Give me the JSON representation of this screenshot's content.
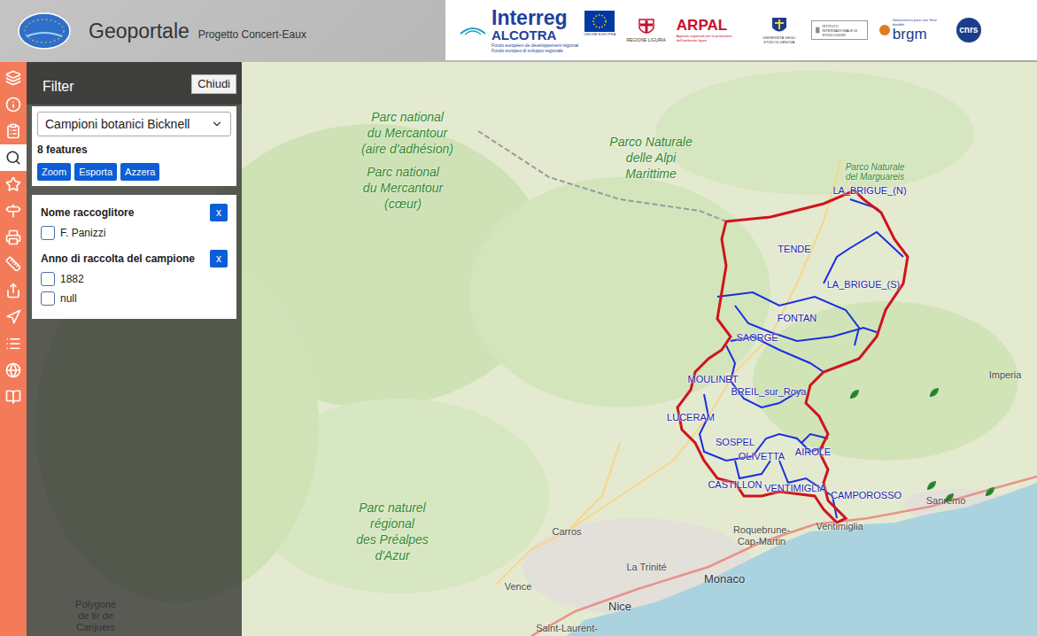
{
  "header": {
    "title": "Geoportale",
    "subtitle": "Progetto Concert-Eaux"
  },
  "partners": {
    "programme": "Interreg",
    "programme_sub": "ALCOTRA",
    "fund_fr": "Fonds européen de développement régional",
    "fund_it": "Fondo europeo di sviluppo regionale",
    "eu": "UNIONE EUROPEA",
    "regione": "REGIONE LIGURIA",
    "arpal": "ARPAL",
    "arpal_caption": "Agenzia regionale per la protezione dell'ambiente ligure",
    "university": "UNIVERSITÀ DEGLI STUDI DI GENOVA",
    "institute": "ISTITUTO INTERNAZIONALE DI STUDI LIGURI",
    "brgm": "brgm",
    "brgm_caption": "Géosciences pour une Terre durable",
    "cnrs": "cnrs"
  },
  "toolbar": [
    {
      "selected": false
    },
    {
      "selected": false
    },
    {
      "selected": false
    },
    {
      "selected": true
    },
    {
      "selected": false
    },
    {
      "selected": false
    },
    {
      "selected": false
    },
    {
      "selected": false
    },
    {
      "selected": false
    },
    {
      "selected": false
    },
    {
      "selected": false
    },
    {
      "selected": false
    },
    {
      "selected": false
    }
  ],
  "filter_panel": {
    "title": "Filter",
    "close": "Chiudi",
    "layer": "Campioni botanici Bicknell",
    "count": "8 features",
    "actions": [
      "Zoom",
      "Esporta",
      "Azzera"
    ],
    "groups": [
      {
        "title": "Nome raccoglitore",
        "clear": "x",
        "options": [
          {
            "label": "F. Panizzi",
            "checked": false
          }
        ]
      },
      {
        "title": "Anno di raccolta del campione",
        "clear": "x",
        "options": [
          {
            "label": "1882",
            "checked": false
          },
          {
            "label": "null",
            "checked": false
          }
        ]
      }
    ]
  },
  "map": {
    "labels": [
      {
        "lines": [
          "Parc national",
          "du Mercantour",
          "(aire d'adhésion)"
        ],
        "kind": "park"
      },
      {
        "lines": [
          "Parc national",
          "du Mercantour",
          "(cœur)"
        ],
        "kind": "park"
      },
      {
        "lines": [
          "Parco Naturale",
          "delle Alpi",
          "Marittime"
        ],
        "kind": "park"
      },
      {
        "lines": [
          "Parco Naturale",
          "del Marguareis"
        ],
        "kind": "smallpark"
      },
      {
        "lines": [
          "Parc naturel",
          "régional",
          "des Préalpes",
          "d'Azur"
        ],
        "kind": "park"
      },
      {
        "lines": [
          "Polygone",
          "de tir de",
          "Canjuers"
        ],
        "kind": "place"
      },
      {
        "lines": [
          "Imperia"
        ],
        "kind": "place"
      },
      {
        "lines": [
          "Sanremo"
        ],
        "kind": "place"
      },
      {
        "lines": [
          "Carros"
        ],
        "kind": "place"
      },
      {
        "lines": [
          "La Trinité"
        ],
        "kind": "place"
      },
      {
        "lines": [
          "Vence"
        ],
        "kind": "place"
      },
      {
        "lines": [
          "Nice"
        ],
        "kind": "city"
      },
      {
        "lines": [
          "Monaco"
        ],
        "kind": "city"
      },
      {
        "lines": [
          "Roquebrune-",
          "Cap-Martin"
        ],
        "kind": "place"
      },
      {
        "lines": [
          "Ventimiglia"
        ],
        "kind": "place"
      },
      {
        "lines": [
          "Saint-Laurent-"
        ],
        "kind": "place"
      },
      {
        "lines": [
          "LA_BRIGUE_(N)"
        ],
        "kind": "commune"
      },
      {
        "lines": [
          "TENDE"
        ],
        "kind": "commune"
      },
      {
        "lines": [
          "LA_BRIGUE_(S)"
        ],
        "kind": "commune"
      },
      {
        "lines": [
          "FONTAN"
        ],
        "kind": "commune"
      },
      {
        "lines": [
          "SAORGE"
        ],
        "kind": "commune"
      },
      {
        "lines": [
          "MOULINET"
        ],
        "kind": "commune"
      },
      {
        "lines": [
          "BREIL_sur_Roya"
        ],
        "kind": "commune"
      },
      {
        "lines": [
          "LUCERAM"
        ],
        "kind": "commune"
      },
      {
        "lines": [
          "SOSPEL"
        ],
        "kind": "commune"
      },
      {
        "lines": [
          "OLIVETTA"
        ],
        "kind": "commune"
      },
      {
        "lines": [
          "AIROLE"
        ],
        "kind": "commune"
      },
      {
        "lines": [
          "CASTILLON"
        ],
        "kind": "commune"
      },
      {
        "lines": [
          "VENTIMIGLIA"
        ],
        "kind": "commune"
      },
      {
        "lines": [
          "CAMPOROSSO"
        ],
        "kind": "commune"
      }
    ],
    "markers": [
      {
        "kind": "leaf"
      },
      {
        "kind": "leaf"
      },
      {
        "kind": "leaf"
      },
      {
        "kind": "leaf"
      },
      {
        "kind": "leaf"
      }
    ]
  }
}
